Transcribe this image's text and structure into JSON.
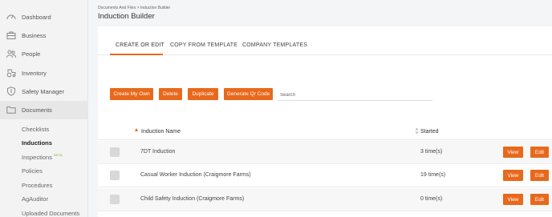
{
  "sidebar": {
    "items": [
      {
        "label": "Dashboard",
        "icon": "dashboard-icon"
      },
      {
        "label": "Business",
        "icon": "briefcase-icon"
      },
      {
        "label": "People",
        "icon": "people-icon"
      },
      {
        "label": "Inventory",
        "icon": "tractor-icon"
      },
      {
        "label": "Safety Manager",
        "icon": "shield-icon"
      },
      {
        "label": "Documents",
        "icon": "folder-icon"
      }
    ],
    "subitems": [
      {
        "label": "Checklists"
      },
      {
        "label": "Inductions"
      },
      {
        "label": "Inspections",
        "badge": "BETA"
      },
      {
        "label": "Policies"
      },
      {
        "label": "Procedures"
      },
      {
        "label": "AgAuditor"
      },
      {
        "label": "Uploaded Documents"
      }
    ]
  },
  "header": {
    "breadcrumb": "Documents And Files > Induction Builder",
    "title": "Induction Builder"
  },
  "tabs": [
    "CREATE OR EDIT",
    "COPY FROM TEMPLATE",
    "COMPANY TEMPLATES"
  ],
  "toolbar": {
    "create_label": "Create My Own",
    "delete_label": "Delete",
    "duplicate_label": "Duplicate",
    "qr_label": "Generate Qr Code",
    "search_placeholder": "Search"
  },
  "table": {
    "columns": {
      "name": "Induction Name",
      "started": "Started"
    },
    "rows": [
      {
        "name": "7DT Induction",
        "started": "3 time(s)"
      },
      {
        "name": "Casual Worker Induction (Craigmore Farms)",
        "started": "19 time(s)"
      },
      {
        "name": "Child Safety Induction (Craigmore Farms)",
        "started": "0 time(s)"
      }
    ],
    "view_label": "View",
    "edit_label": "Edit"
  },
  "colors": {
    "accent": "#e8691c",
    "badge": "#79b52a"
  }
}
